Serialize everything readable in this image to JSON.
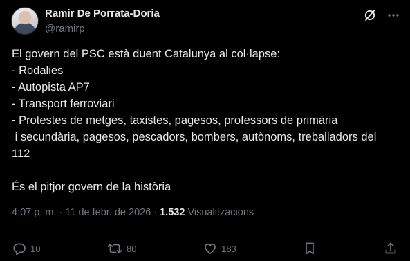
{
  "author": {
    "name": "Ramir De Porrata-Doria",
    "handle": "@ramirp"
  },
  "post": {
    "lines": [
      "El govern del PSC està duent Catalunya al col·lapse:",
      "- Rodalies",
      "- Autopista AP7",
      "- Transport ferroviari",
      "- Protestes de metges, taxistes, pagesos, professors de primària",
      " i secundària, pagesos, pescadors, bombers, autònoms, treballadors del",
      "112",
      "",
      "És el pitjor govern de la història"
    ]
  },
  "meta": {
    "timestamp": "4:07 p. m. · 11 de febr. de 2026 ·",
    "views_count": "1.532",
    "views_label": "Visualitzacions"
  },
  "actions": {
    "replies": "10",
    "reposts": "80",
    "likes": "183"
  },
  "icons": {
    "top_right": [
      "grok-icon",
      "more-icon"
    ],
    "actions": [
      "reply-icon",
      "repost-icon",
      "like-icon",
      "bookmark-icon",
      "share-icon"
    ]
  },
  "colors": {
    "background": "#000000",
    "text": "#e7e9ea",
    "secondary": "#71767b"
  }
}
